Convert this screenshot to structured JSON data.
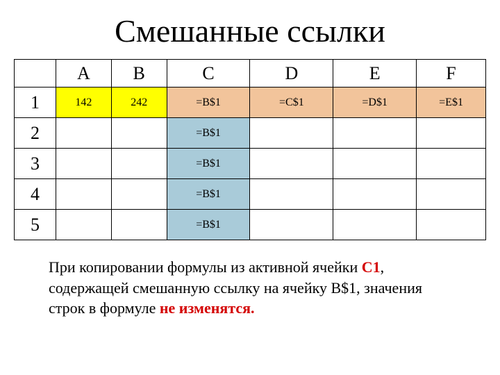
{
  "title": "Смешанные ссылки",
  "headers": {
    "corner": "",
    "a": "A",
    "b": "B",
    "c": "C",
    "d": "D",
    "e": "E",
    "f": "F"
  },
  "rows": {
    "r1": {
      "label": "1",
      "a": "142",
      "b": "242",
      "c": "=B$1",
      "d": "=C$1",
      "e": "=D$1",
      "f": "=E$1"
    },
    "r2": {
      "label": "2",
      "c": "=B$1"
    },
    "r3": {
      "label": "3",
      "c": "=B$1"
    },
    "r4": {
      "label": "4",
      "c": "=B$1"
    },
    "r5": {
      "label": "5",
      "c": "=B$1"
    }
  },
  "caption": {
    "p1a": "При копировании формулы из активной ячейки ",
    "p1b": "С1",
    "p1c": ",",
    "p2": "содержащей смешанную ссылку на ячейку B$1, значения",
    "p3a": "строк в формуле ",
    "p3b": "не изменятся."
  },
  "chart_data": {
    "type": "table",
    "title": "Смешанные ссылки",
    "columns": [
      "",
      "A",
      "B",
      "C",
      "D",
      "E",
      "F"
    ],
    "rows": [
      [
        "1",
        "142",
        "242",
        "=B$1",
        "=C$1",
        "=D$1",
        "=E$1"
      ],
      [
        "2",
        "",
        "",
        "=B$1",
        "",
        "",
        ""
      ],
      [
        "3",
        "",
        "",
        "=B$1",
        "",
        "",
        ""
      ],
      [
        "4",
        "",
        "",
        "=B$1",
        "",
        "",
        ""
      ],
      [
        "5",
        "",
        "",
        "=B$1",
        "",
        "",
        ""
      ]
    ],
    "highlights": {
      "yellow": [
        "A1",
        "B1"
      ],
      "tan": [
        "C1",
        "D1",
        "E1",
        "F1"
      ],
      "blue": [
        "C2",
        "C3",
        "C4",
        "C5"
      ]
    },
    "note": "При копировании формулы из активной ячейки С1, содержащей смешанную ссылку на ячейку B$1, значения строк в формуле не изменятся."
  }
}
